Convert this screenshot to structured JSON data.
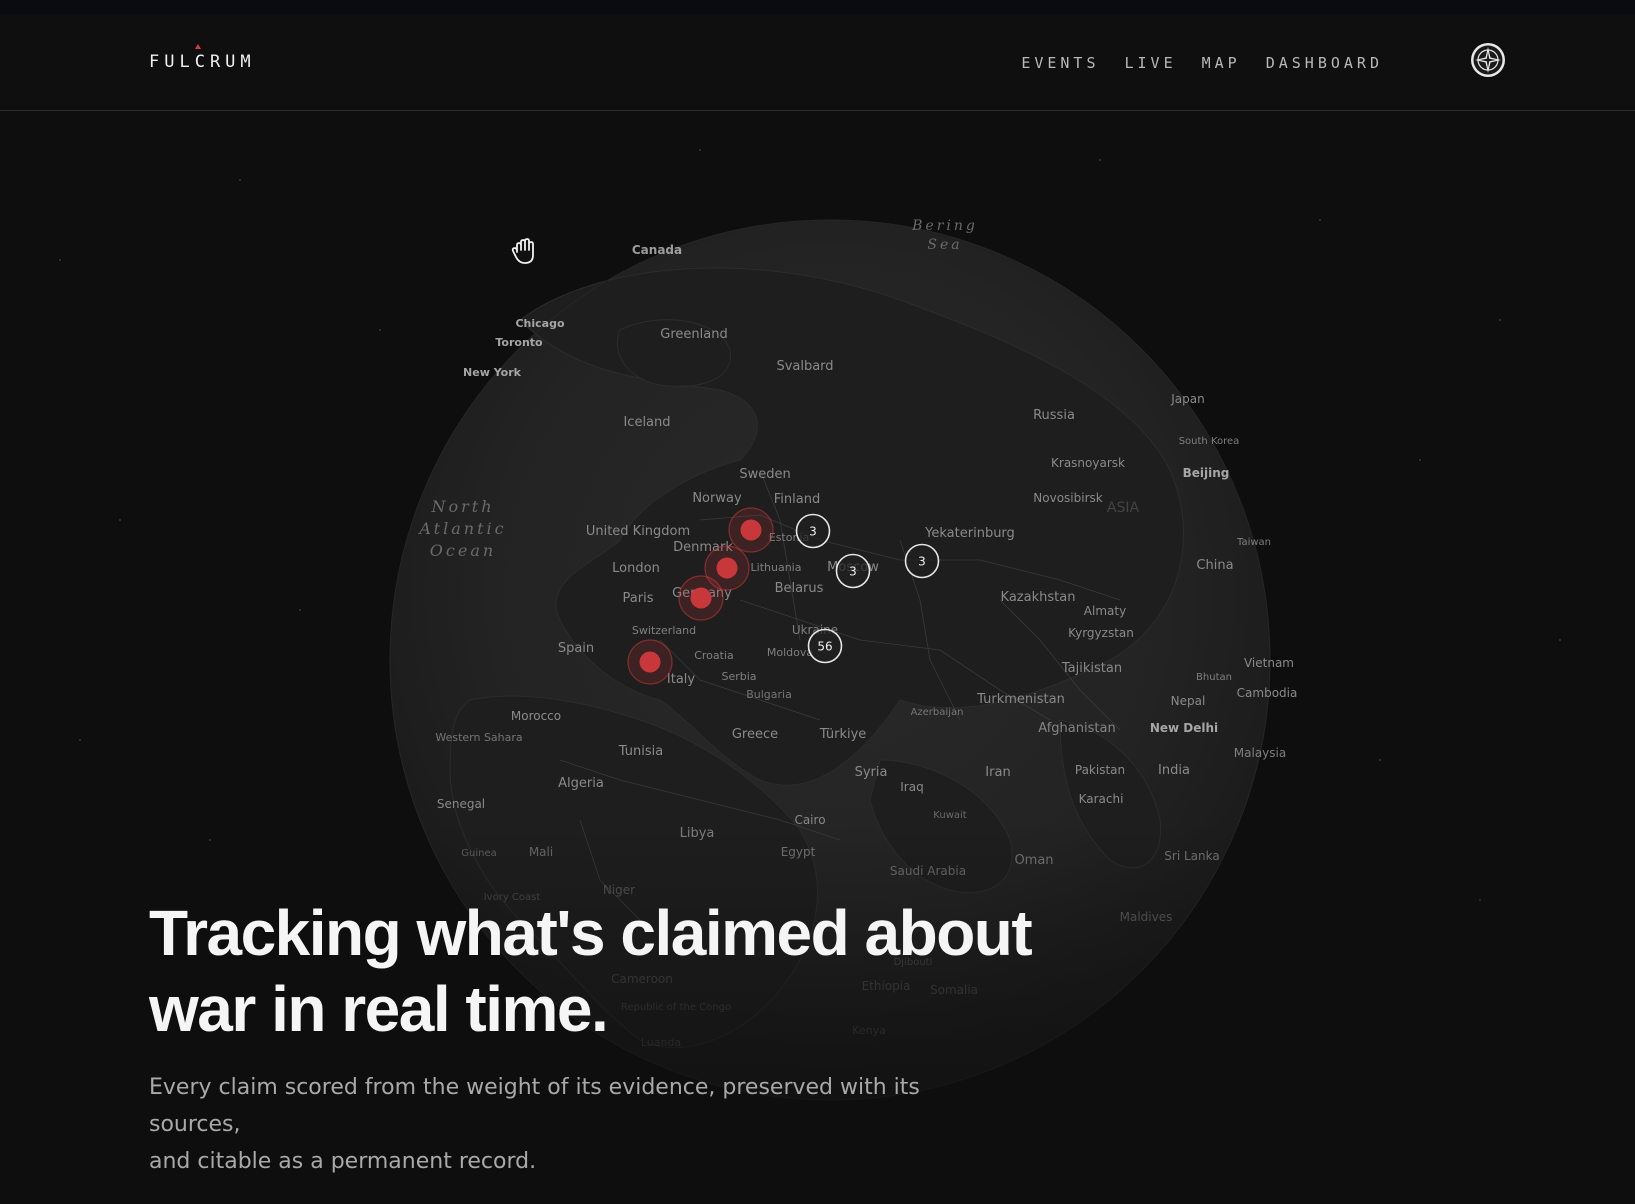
{
  "brand": {
    "name": "FULCRUM",
    "accent": "#d63b3b"
  },
  "nav": {
    "items": [
      {
        "label": "EVENTS"
      },
      {
        "label": "LIVE"
      },
      {
        "label": "MAP"
      },
      {
        "label": "DASHBOARD"
      }
    ],
    "emblem_icon": "compass-rose-icon"
  },
  "map": {
    "cursor_icon": "grab-hand-icon",
    "oceans": [
      {
        "lines": [
          "Bering",
          "Sea"
        ]
      },
      {
        "lines": [
          "North",
          "Atlantic",
          "Ocean"
        ]
      }
    ],
    "places": [
      "Canada",
      "Chicago",
      "Toronto",
      "New York",
      "Greenland",
      "Svalbard",
      "Iceland",
      "Russia",
      "Japan",
      "South Korea",
      "Krasnoyarsk",
      "Beijing",
      "Novosibirsk",
      "Sweden",
      "Norway",
      "Finland",
      "United Kingdom",
      "Denmark",
      "London",
      "Estonia",
      "Lithuania",
      "Moscow",
      "Yekaterinburg",
      "Taiwan",
      "China",
      "Paris",
      "Germany",
      "Belarus",
      "Kazakhstan",
      "Almaty",
      "Kyrgyzstan",
      "Switzerland",
      "Spain",
      "Ukraine",
      "Moldova",
      "Croatia",
      "Tajikistan",
      "Vietnam",
      "Serbia",
      "Italy",
      "Bhutan",
      "Cambodia",
      "Bulgaria",
      "Nepal",
      "Turkmenistan",
      "Azerbaijan",
      "Morocco",
      "Afghanistan",
      "New Delhi",
      "Western Sahara",
      "Greece",
      "Türkiye",
      "Malaysia",
      "Tunisia",
      "Syria",
      "Iran",
      "Pakistan",
      "India",
      "Algeria",
      "Iraq",
      "Karachi",
      "Senegal",
      "Kuwait",
      "Cairo",
      "Libya",
      "Guinea",
      "Mali",
      "Egypt",
      "Oman",
      "Sri Lanka",
      "Saudi Arabia",
      "Niger",
      "Ivory Coast",
      "Maldives",
      "Cameroon",
      "Djibouti",
      "Ethiopia",
      "Somalia",
      "Republic of the Congo",
      "Kenya",
      "Luanda",
      "ASIA"
    ],
    "clusters": [
      {
        "count": "3"
      },
      {
        "count": "3"
      },
      {
        "count": "3"
      },
      {
        "count": "56"
      }
    ],
    "event_markers": 4,
    "marker_color": "#c8383b"
  },
  "hero": {
    "title_line1": "Tracking what's claimed about",
    "title_line2": "war in real time.",
    "subtitle_line1": "Every claim scored from the weight of its evidence, preserved with its sources,",
    "subtitle_line2": "and citable as a permanent record."
  }
}
